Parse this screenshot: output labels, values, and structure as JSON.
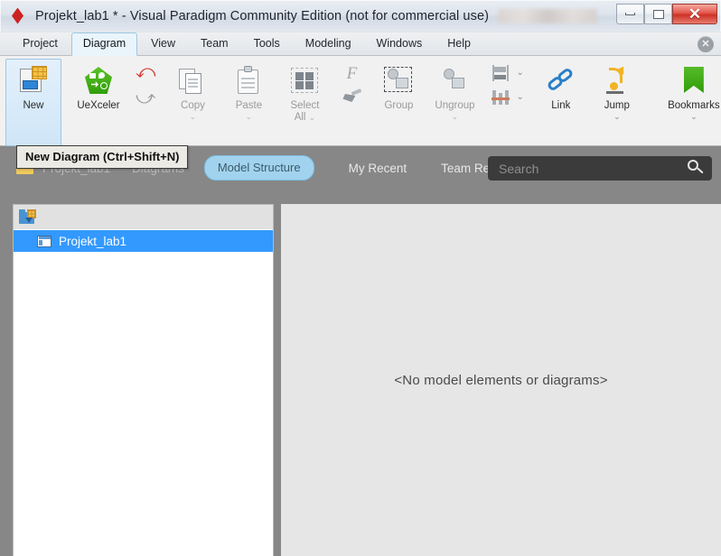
{
  "window": {
    "title": "Projekt_lab1 * - Visual Paradigm Community Edition (not for commercial use)",
    "app_icon": "diamond-logo-icon",
    "minimize_label": "Minimize",
    "maximize_label": "Maximize",
    "close_label": "✕"
  },
  "menubar": {
    "items": [
      {
        "label": "Project",
        "active": false
      },
      {
        "label": "Diagram",
        "active": true
      },
      {
        "label": "View",
        "active": false
      },
      {
        "label": "Team",
        "active": false
      },
      {
        "label": "Tools",
        "active": false
      },
      {
        "label": "Modeling",
        "active": false
      },
      {
        "label": "Windows",
        "active": false
      },
      {
        "label": "Help",
        "active": false
      }
    ],
    "close_glyph": "✕"
  },
  "ribbon": {
    "new": {
      "label": "New",
      "selected": true
    },
    "uexceler": {
      "label": "UeXceler"
    },
    "copy": {
      "label": "Copy",
      "chevron": "⌄",
      "disabled": true
    },
    "paste": {
      "label": "Paste",
      "chevron": "⌄",
      "disabled": true
    },
    "select_all": {
      "label": "Select",
      "label2": "All",
      "chevron": "⌄",
      "disabled": true
    },
    "group": {
      "label": "Group",
      "disabled": true
    },
    "ungroup": {
      "label": "Ungroup",
      "chevron": "⌄",
      "disabled": true
    },
    "link": {
      "label": "Link"
    },
    "jump": {
      "label": "Jump",
      "chevron": "⌄"
    },
    "bookmarks": {
      "label": "Bookmarks",
      "chevron": "⌄"
    },
    "format_glyph": "F",
    "align_chevron": "⌄",
    "distribute_chevron": "⌄",
    "undo_glyph": "⤺",
    "redo_glyph": "⤻"
  },
  "tooltip": {
    "text": "New Diagram (Ctrl+Shift+N)"
  },
  "navbar": {
    "breadcrumb": [
      {
        "label": "Projekt_lab1"
      },
      {
        "label": "Diagrams"
      }
    ],
    "active_pill": "Model Structure",
    "links": [
      {
        "label": "My Recent"
      },
      {
        "label": "Team Recent"
      }
    ],
    "search": {
      "placeholder": "Search",
      "value": "",
      "icon": "search-icon"
    }
  },
  "tree": {
    "toolbar_icon": "open-project-folder-icon",
    "nodes": [
      {
        "label": "Projekt_lab1",
        "selected": true,
        "icon": "diagram-node-icon"
      }
    ]
  },
  "content": {
    "empty_message": "<No model elements or diagrams>"
  },
  "colors": {
    "accent_blue": "#3399ff",
    "chrome_gray": "#878787",
    "ribbon_bg": "#f1f1f1",
    "pill_blue": "#a2d3ee",
    "close_red": "#cc3225"
  }
}
